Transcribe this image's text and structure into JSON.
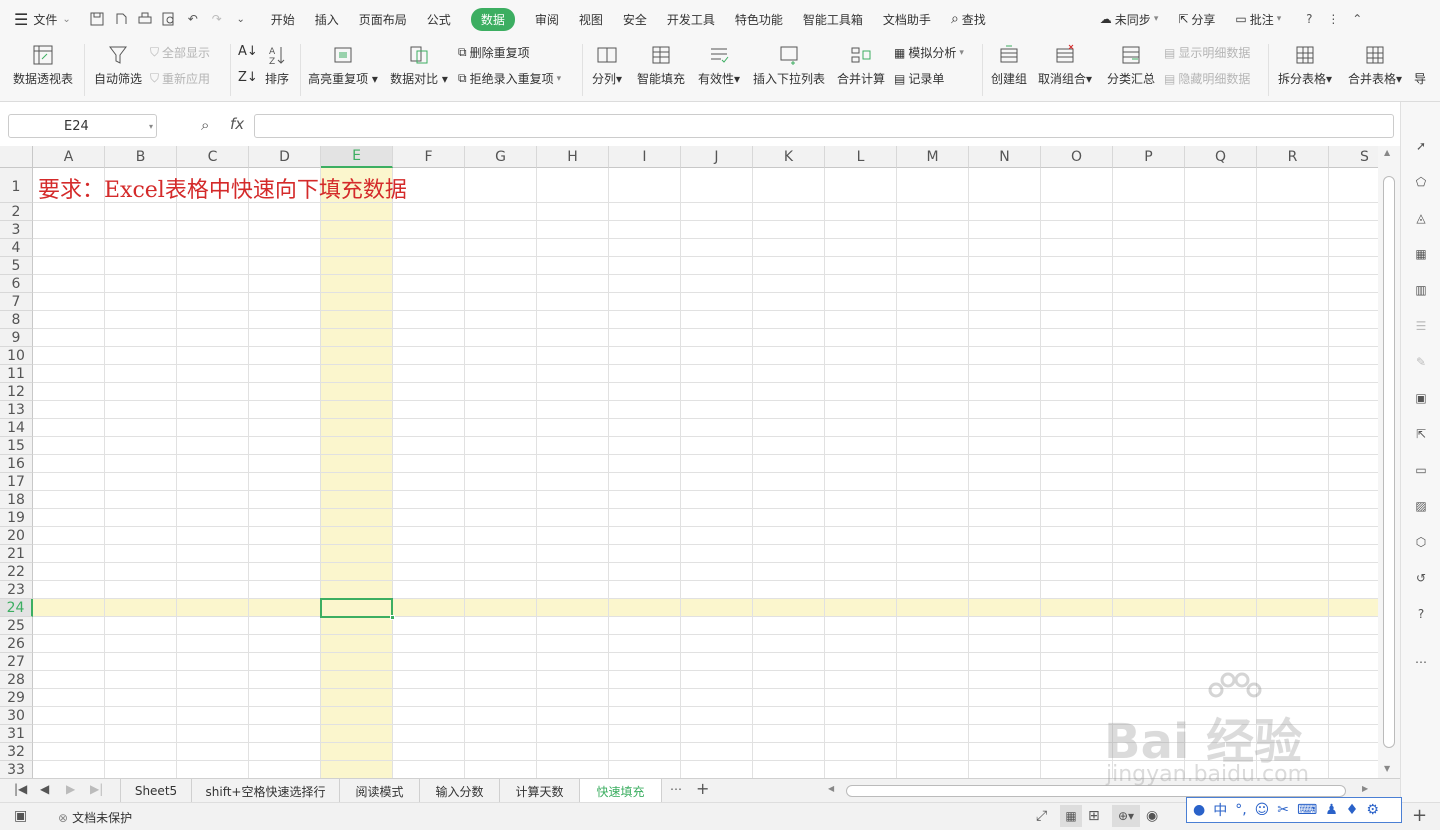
{
  "menu": {
    "file": "文件",
    "tabs": [
      "开始",
      "插入",
      "页面布局",
      "公式",
      "数据",
      "审阅",
      "视图",
      "安全",
      "开发工具",
      "特色功能",
      "智能工具箱",
      "文档助手"
    ],
    "active_tab": "数据",
    "search": "查找",
    "sync": "未同步",
    "share": "分享",
    "comment": "批注"
  },
  "ribbon": {
    "pivot": "数据透视表",
    "autofilter": "自动筛选",
    "show_all": "全部显示",
    "reapply": "重新应用",
    "sort": "排序",
    "highlight_dup": "高亮重复项",
    "compare": "数据对比",
    "delete_dup": "删除重复项",
    "reject_dup": "拒绝录入重复项",
    "split_col": "分列",
    "smart_fill": "智能填充",
    "validity": "有效性",
    "insert_dropdown": "插入下拉列表",
    "consolidate": "合并计算",
    "whatif": "模拟分析",
    "record_form": "记录单",
    "create_group": "创建组",
    "ungroup": "取消组合",
    "subtotal": "分类汇总",
    "show_detail": "显示明细数据",
    "hide_detail": "隐藏明细数据",
    "split_table": "拆分表格",
    "merge_table": "合并表格",
    "more": "导"
  },
  "formula": {
    "namebox": "E24",
    "fx": "fx",
    "value": ""
  },
  "sheet": {
    "columns": [
      "A",
      "B",
      "C",
      "D",
      "E",
      "F",
      "G",
      "H",
      "I",
      "J",
      "K",
      "L",
      "M",
      "N",
      "O",
      "P",
      "Q",
      "R",
      "S"
    ],
    "rows": [
      "1",
      "2",
      "3",
      "4",
      "5",
      "6",
      "7",
      "8",
      "9",
      "10",
      "11",
      "12",
      "13",
      "14",
      "15",
      "16",
      "17",
      "18",
      "19",
      "20",
      "21",
      "22",
      "23",
      "24",
      "25",
      "26",
      "27",
      "28",
      "29",
      "30",
      "31",
      "32",
      "33"
    ],
    "active_col": "E",
    "active_row": "24",
    "a1_text": "要求：Excel表格中快速向下填充数据",
    "a1_color": "#d42a2a",
    "highlight_color": "#fbf6cd",
    "accent": "#3cae61"
  },
  "tabs": [
    "Sheet5",
    "shift+空格快速选择行",
    "阅读模式",
    "输入分数",
    "计算天数",
    "快速填充"
  ],
  "active_sheet_tab": "快速填充",
  "status": {
    "protect": "文档未保护"
  },
  "watermark": {
    "logo": "Bai 经验",
    "url": "jingyan.baidu.com"
  },
  "ime": {
    "lang": "中"
  }
}
